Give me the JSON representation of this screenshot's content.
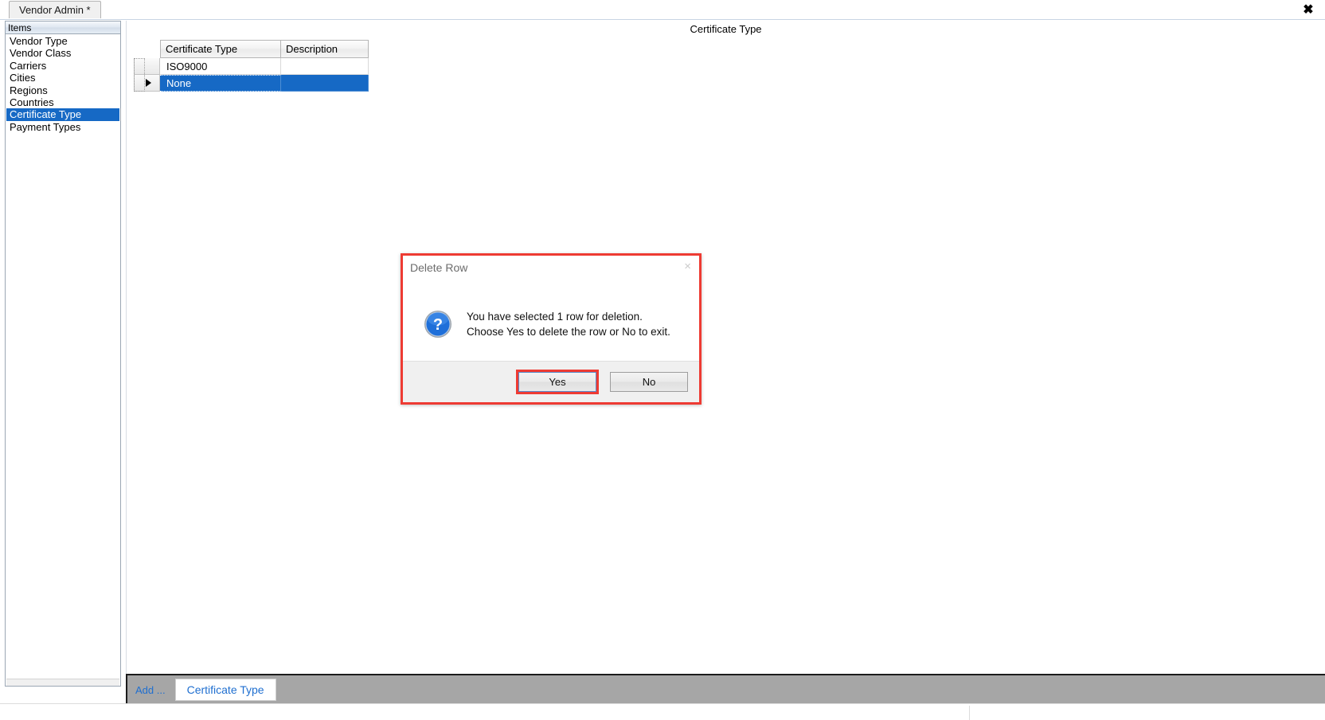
{
  "window": {
    "close_label": "✖"
  },
  "tabstrip": {
    "active_tab": "Vendor Admin *"
  },
  "sidebar": {
    "header": "Items",
    "items": [
      {
        "label": "Vendor Type",
        "selected": false
      },
      {
        "label": "Vendor Class",
        "selected": false
      },
      {
        "label": "Carriers",
        "selected": false
      },
      {
        "label": "Cities",
        "selected": false
      },
      {
        "label": "Regions",
        "selected": false
      },
      {
        "label": "Countries",
        "selected": false
      },
      {
        "label": "Certificate Type",
        "selected": true
      },
      {
        "label": "Payment Types",
        "selected": false
      }
    ]
  },
  "main": {
    "title": "Certificate Type",
    "grid": {
      "columns": [
        "Certificate Type",
        "Description"
      ],
      "rows": [
        {
          "certificate_type": "ISO9000",
          "description": "",
          "selected": false,
          "current": false
        },
        {
          "certificate_type": "None",
          "description": "",
          "selected": true,
          "current": true
        }
      ]
    }
  },
  "bottom_bar": {
    "add_label": "Add ...",
    "tab_label": "Certificate Type"
  },
  "dialog": {
    "title": "Delete Row",
    "close_label": "×",
    "icon": "question-icon",
    "message_line1": "You have selected 1 row for deletion.",
    "message_line2": "Choose Yes to delete the row or No to exit.",
    "yes_label": "Yes",
    "no_label": "No"
  },
  "colors": {
    "accent_blue": "#1669c5",
    "highlight_red": "#ee3b33",
    "link_blue": "#1f6fd0",
    "toolbar_gray": "#a6a6a6"
  }
}
